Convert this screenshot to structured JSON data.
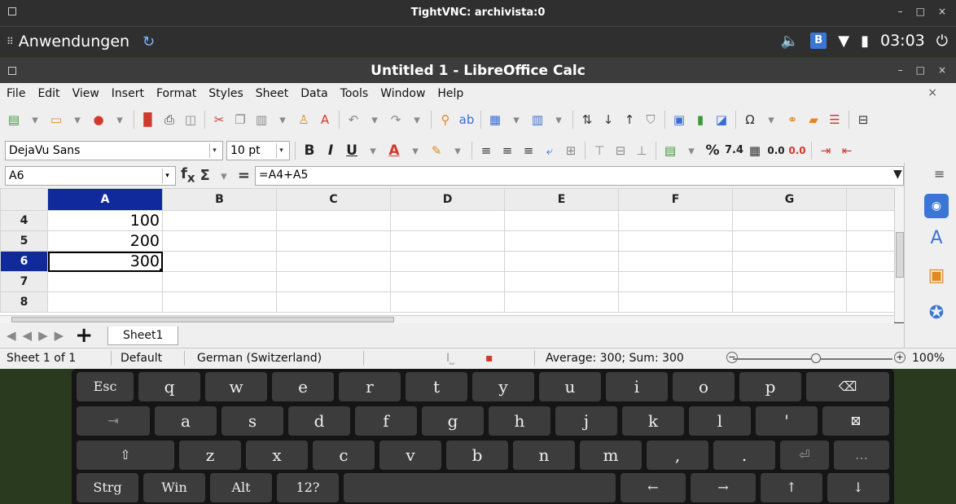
{
  "vnc": {
    "title": "TightVNC: archivista:0",
    "controls": [
      "–",
      "□",
      "×"
    ]
  },
  "panel": {
    "apps_label": "Anwendungen",
    "clock": "03:03",
    "tray_badge": "B"
  },
  "window": {
    "title": "Untitled 1 - LibreOffice Calc",
    "controls": [
      "–",
      "□",
      "×"
    ]
  },
  "menu": [
    "File",
    "Edit",
    "View",
    "Insert",
    "Format",
    "Styles",
    "Sheet",
    "Data",
    "Tools",
    "Window",
    "Help"
  ],
  "format": {
    "font_name": "DejaVu Sans",
    "font_size": "10 pt"
  },
  "formula": {
    "cell_ref": "A6",
    "content": "=A4+A5"
  },
  "sheet": {
    "columns": [
      "A",
      "B",
      "C",
      "D",
      "E",
      "F",
      "G"
    ],
    "rows": [
      {
        "num": "4",
        "a": "100"
      },
      {
        "num": "5",
        "a": "200"
      },
      {
        "num": "6",
        "a": "300"
      },
      {
        "num": "7",
        "a": ""
      },
      {
        "num": "8",
        "a": ""
      }
    ],
    "active_row": "6",
    "tab_name": "Sheet1"
  },
  "status": {
    "sheet_pos": "Sheet 1 of 1",
    "page_style": "Default",
    "language": "German (Switzerland)",
    "summary": "Average: 300; Sum: 300",
    "zoom": "100%"
  },
  "keyboard": {
    "row1": [
      "Esc",
      "q",
      "w",
      "e",
      "r",
      "t",
      "y",
      "u",
      "i",
      "o",
      "p",
      "⌫"
    ],
    "row2": [
      "⇥",
      "a",
      "s",
      "d",
      "f",
      "g",
      "h",
      "j",
      "k",
      "l",
      "'",
      "⊠"
    ],
    "row3": [
      "⇧",
      "z",
      "x",
      "c",
      "v",
      "b",
      "n",
      "m",
      ",",
      ".",
      "⏎",
      "…"
    ],
    "row4": [
      "Strg",
      "Win",
      "Alt",
      "12?",
      "",
      "←",
      "→",
      "↑",
      "↓"
    ]
  },
  "colors": {
    "selection_header": "#102a9c",
    "keyboard_bg": "#151515",
    "key_bg": "#3c3c3c"
  }
}
